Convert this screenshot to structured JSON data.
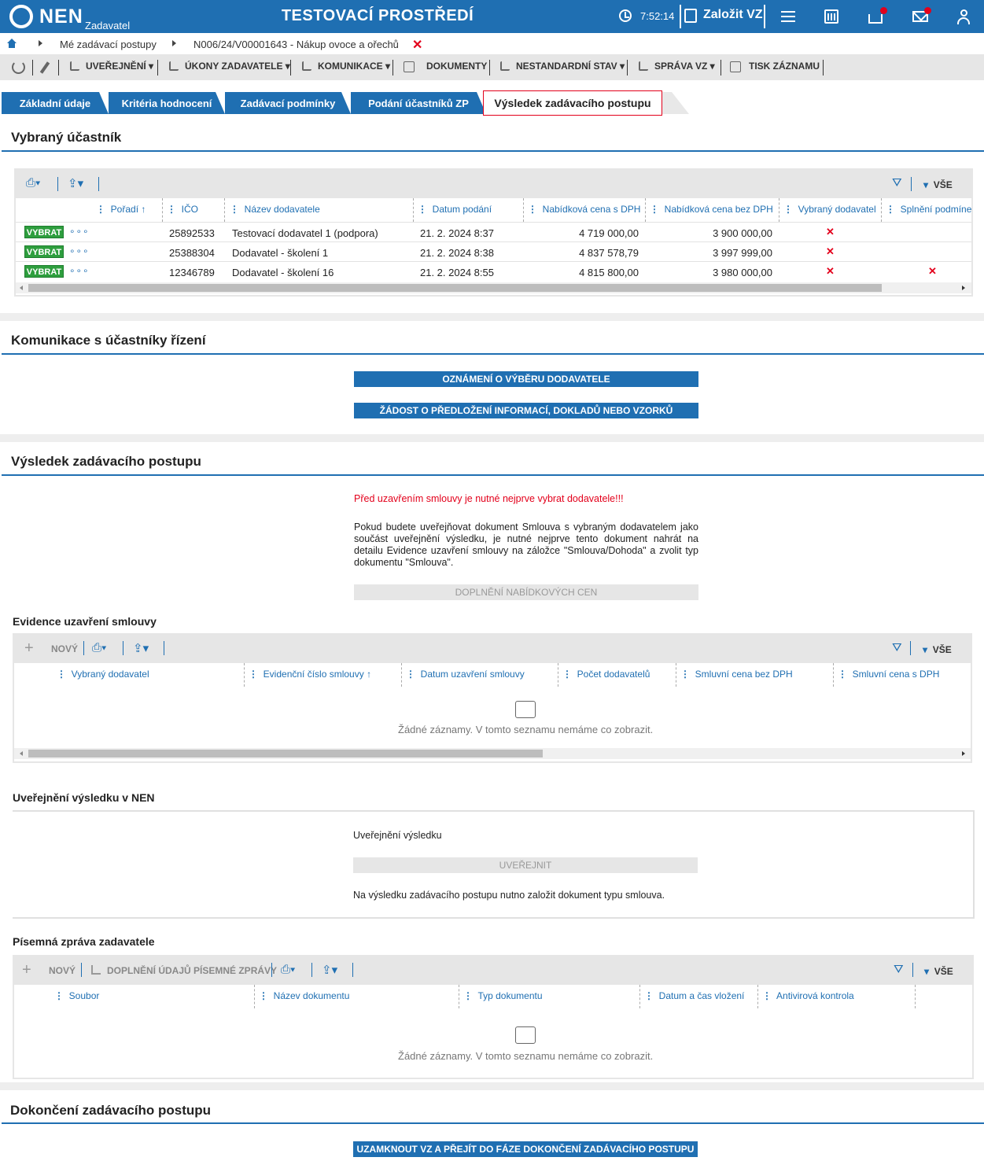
{
  "topbar": {
    "logo": "NEN",
    "logo_sub": "Zadavatel",
    "env_title": "TESTOVACÍ PROSTŘEDÍ",
    "clock": "7:52:14",
    "create_label": "Založit VZ"
  },
  "breadcrumb": {
    "item1": "Mé zadávací postupy",
    "item2": "N006/24/V00001643 - Nákup ovoce a ořechů",
    "close": "✕"
  },
  "actions": [
    "UVEŘEJNĚNÍ",
    "ÚKONY ZADAVATELE",
    "KOMUNIKACE",
    "DOKUMENTY",
    "NESTANDARDNÍ STAV",
    "SPRÁVA VZ",
    "TISK ZÁZNAMU"
  ],
  "tabs": [
    "Základní údaje",
    "Kritéria hodnocení",
    "Zadávací podmínky",
    "Podání účastníků ZP"
  ],
  "active_tab": "Výsledek zadávacího postupu",
  "vybrany": {
    "title": "Vybraný účastník",
    "vse": "VŠE",
    "columns": [
      "Pořadí",
      "IČO",
      "Název dodavatele",
      "Datum podání",
      "Nabídková cena s DPH",
      "Nabídková cena bez DPH",
      "Vybraný dodavatel",
      "Splnění podmínek"
    ],
    "select_label": "VYBRAT",
    "rows": [
      {
        "ico": "25892533",
        "nazev": "Testovací dodavatel 1 (podpora)",
        "datum": "21. 2. 2024 8:37",
        "s_dph": "4 719 000,00",
        "bez_dph": "3 900 000,00",
        "vybrany": "✕",
        "splneni": ""
      },
      {
        "ico": "25388304",
        "nazev": "Dodavatel - školení 1",
        "datum": "21. 2. 2024 8:38",
        "s_dph": "4 837 578,79",
        "bez_dph": "3 997 999,00",
        "vybrany": "✕",
        "splneni": ""
      },
      {
        "ico": "12346789",
        "nazev": "Dodavatel - školení 16",
        "datum": "21. 2. 2024 8:55",
        "s_dph": "4 815 800,00",
        "bez_dph": "3 980 000,00",
        "vybrany": "✕",
        "splneni": "✕"
      }
    ]
  },
  "komunikace": {
    "title": "Komunikace s účastníky řízení",
    "btn1": "OZNÁMENÍ O VÝBĚRU DODAVATELE",
    "btn2": "ŽÁDOST O PŘEDLOŽENÍ INFORMACÍ, DOKLADŮ NEBO VZORKŮ"
  },
  "vysledek": {
    "title": "Výsledek zadávacího postupu",
    "warning": "Před uzavřením smlouvy je nutné nejprve vybrat dodavatele!!!",
    "info": "Pokud budete uveřejňovat dokument Smlouva s vybraným dodavatelem jako součást uveřejnění výsledku, je nutné nejprve tento dokument nahrát na detailu Evidence uzavření smlouvy na záložce \"Smlouva/Dohoda\" a zvolit typ dokumentu \"Smlouva\".",
    "btn_doplneni": "DOPLNĚNÍ NABÍDKOVÝCH CEN"
  },
  "evidence": {
    "title": "Evidence uzavření smlouvy",
    "new": "NOVÝ",
    "vse": "VŠE",
    "columns": [
      "Vybraný dodavatel",
      "Evidenční číslo smlouvy",
      "Datum uzavření smlouvy",
      "Počet dodavatelů",
      "Smluvní cena bez DPH",
      "Smluvní cena s DPH"
    ],
    "empty": "Žádné záznamy. V tomto seznamu nemáme co zobrazit."
  },
  "uverejneni": {
    "title": "Uveřejnění výsledku v NEN",
    "label": "Uveřejnění výsledku",
    "btn": "UVEŘEJNIT",
    "note": "Na výsledku zadávacího postupu nutno založit dokument typu smlouva."
  },
  "pisemna": {
    "title": "Písemná zpráva zadavatele",
    "new": "NOVÝ",
    "doplneni": "DOPLNĚNÍ ÚDAJŮ PÍSEMNÉ ZPRÁVY",
    "vse": "VŠE",
    "columns": [
      "Soubor",
      "Název dokumentu",
      "Typ dokumentu",
      "Datum a čas vložení",
      "Antivirová kontrola"
    ],
    "empty": "Žádné záznamy. V tomto seznamu nemáme co zobrazit."
  },
  "dokonceni": {
    "title": "Dokončení zadávacího postupu",
    "btn": "UZAMKNOUT VZ A PŘEJÍT DO FÁZE DOKONČENÍ ZADÁVACÍHO POSTUPU"
  },
  "colors": {
    "brand": "#1f6fb2",
    "alert": "#e3001b",
    "select": "#2e9e3e"
  }
}
